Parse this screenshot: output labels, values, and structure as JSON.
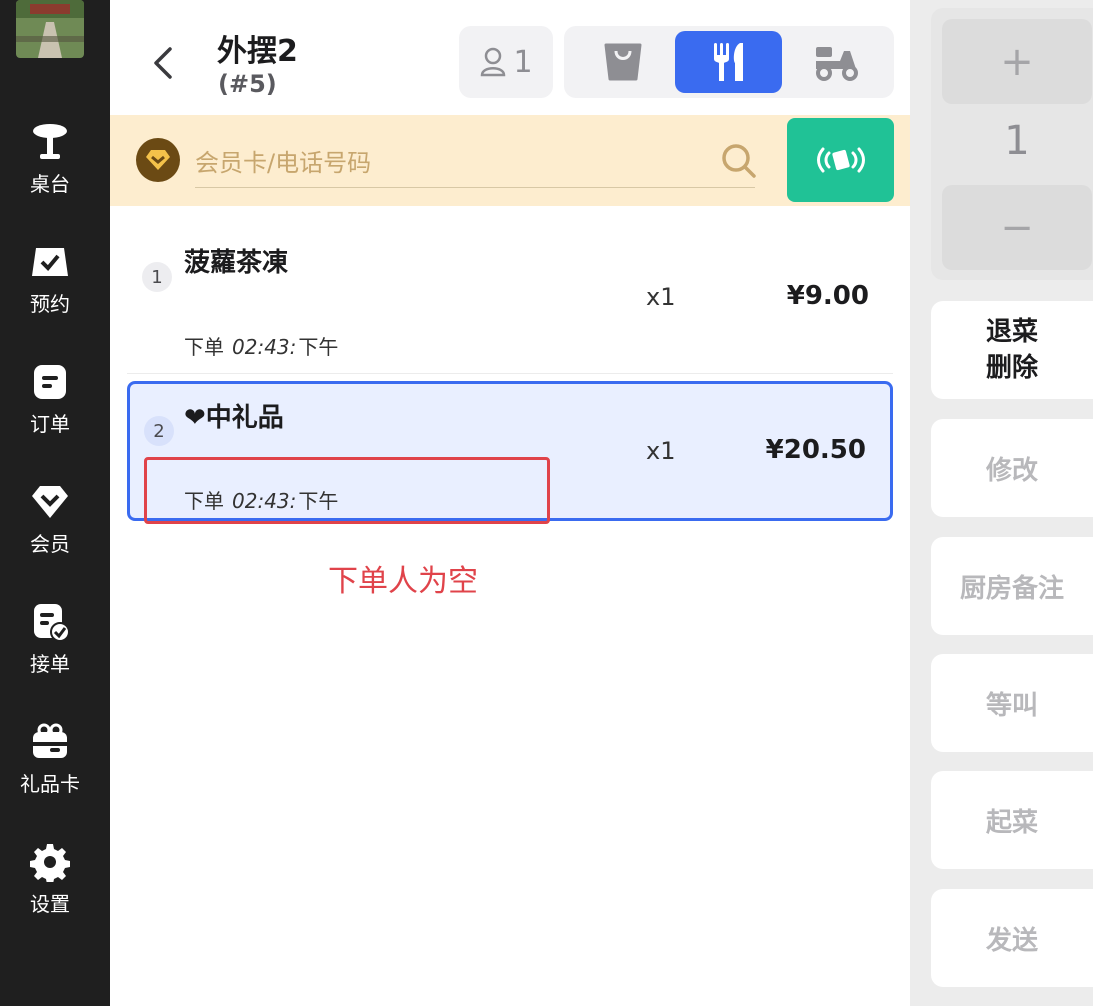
{
  "sidebar": {
    "items": [
      {
        "label": "桌台",
        "icon": "table-icon"
      },
      {
        "label": "预约",
        "icon": "reservation-icon"
      },
      {
        "label": "订单",
        "icon": "order-icon"
      },
      {
        "label": "会员",
        "icon": "member-icon"
      },
      {
        "label": "接单",
        "icon": "accept-order-icon"
      },
      {
        "label": "礼品卡",
        "icon": "gift-card-icon"
      },
      {
        "label": "设置",
        "icon": "gear-icon"
      }
    ]
  },
  "header": {
    "title": "外摆2",
    "subtitle": "(#5)",
    "guest_count": "1",
    "modes": [
      {
        "name": "takeaway",
        "icon": "bag-icon",
        "active": false
      },
      {
        "name": "dine-in",
        "icon": "cutlery-icon",
        "active": true
      },
      {
        "name": "delivery",
        "icon": "scooter-icon",
        "active": false
      }
    ]
  },
  "member": {
    "placeholder": "会员卡/电话号码"
  },
  "order_items": [
    {
      "index": "1",
      "name": "菠蘿茶凍",
      "qty": "x1",
      "price": "¥9.00",
      "meta_prefix": "下单",
      "time": "02:43:",
      "period": "下午",
      "selected": false
    },
    {
      "index": "2",
      "name": "❤中礼品",
      "qty": "x1",
      "price": "¥20.50",
      "meta_prefix": "下单",
      "time": "02:43:",
      "period": "下午",
      "selected": true
    }
  ],
  "annotation": {
    "text": "下单人为空"
  },
  "right_panel": {
    "plus": "+",
    "minus": "−",
    "quantity": "1",
    "actions": [
      {
        "label_line1": "退菜",
        "label_line2": "删除"
      },
      {
        "label": "修改"
      },
      {
        "label": "厨房备注"
      },
      {
        "label": "等叫"
      },
      {
        "label": "起菜"
      },
      {
        "label": "发送"
      }
    ]
  },
  "colors": {
    "accent": "#3a6bf0",
    "nfc": "#20c296",
    "member_bar": "#fdedcf",
    "annotation": "#e0434a",
    "sidebar": "#1f1f1f"
  }
}
